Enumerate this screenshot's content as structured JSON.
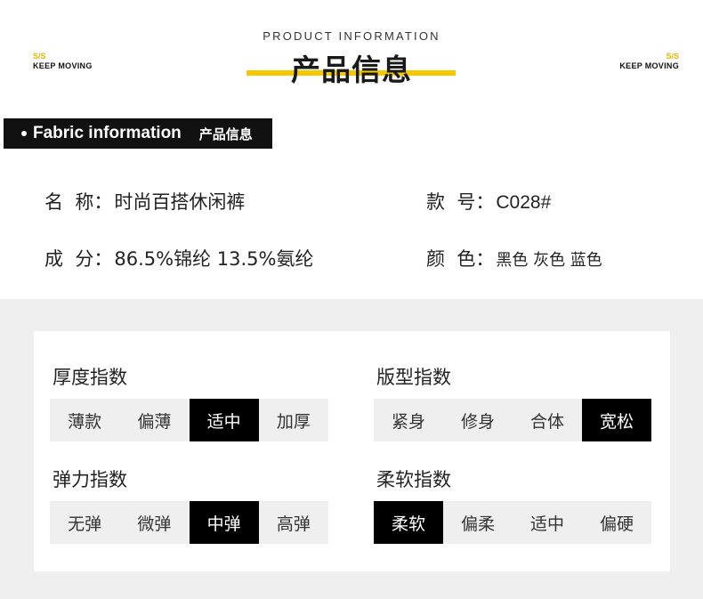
{
  "brand": {
    "ss": "S/S",
    "motto": "KEEP MOVING"
  },
  "header": {
    "subtitle": "PRODUCT INFORMATION",
    "title": "产品信息"
  },
  "section_tag": {
    "en": "Fabric information",
    "cn": "产品信息"
  },
  "info": {
    "name": {
      "label": "名  称",
      "colon": "：",
      "value": "时尚百搭休闲裤"
    },
    "model": {
      "label": "款  号",
      "colon": "：",
      "value": "C028#"
    },
    "composition": {
      "label": "成  分",
      "colon": "：",
      "value": "86.5%锦纶 13.5%氨纶"
    },
    "color": {
      "label": "颜  色",
      "colon": "：",
      "value": "黑色 灰色 蓝色"
    }
  },
  "indices": [
    {
      "title": "厚度指数",
      "options": [
        "薄款",
        "偏薄",
        "适中",
        "加厚"
      ],
      "selected_index": 2
    },
    {
      "title": "版型指数",
      "options": [
        "紧身",
        "修身",
        "合体",
        "宽松"
      ],
      "selected_index": 3
    },
    {
      "title": "弹力指数",
      "options": [
        "无弹",
        "微弹",
        "中弹",
        "高弹"
      ],
      "selected_index": 2
    },
    {
      "title": "柔软指数",
      "options": [
        "柔软",
        "偏柔",
        "适中",
        "偏硬"
      ],
      "selected_index": 0
    }
  ],
  "colors": {
    "accent": "#f5c800",
    "selected": "#000000",
    "scale_bg": "#efefef",
    "panel_bg": "#efefef"
  }
}
